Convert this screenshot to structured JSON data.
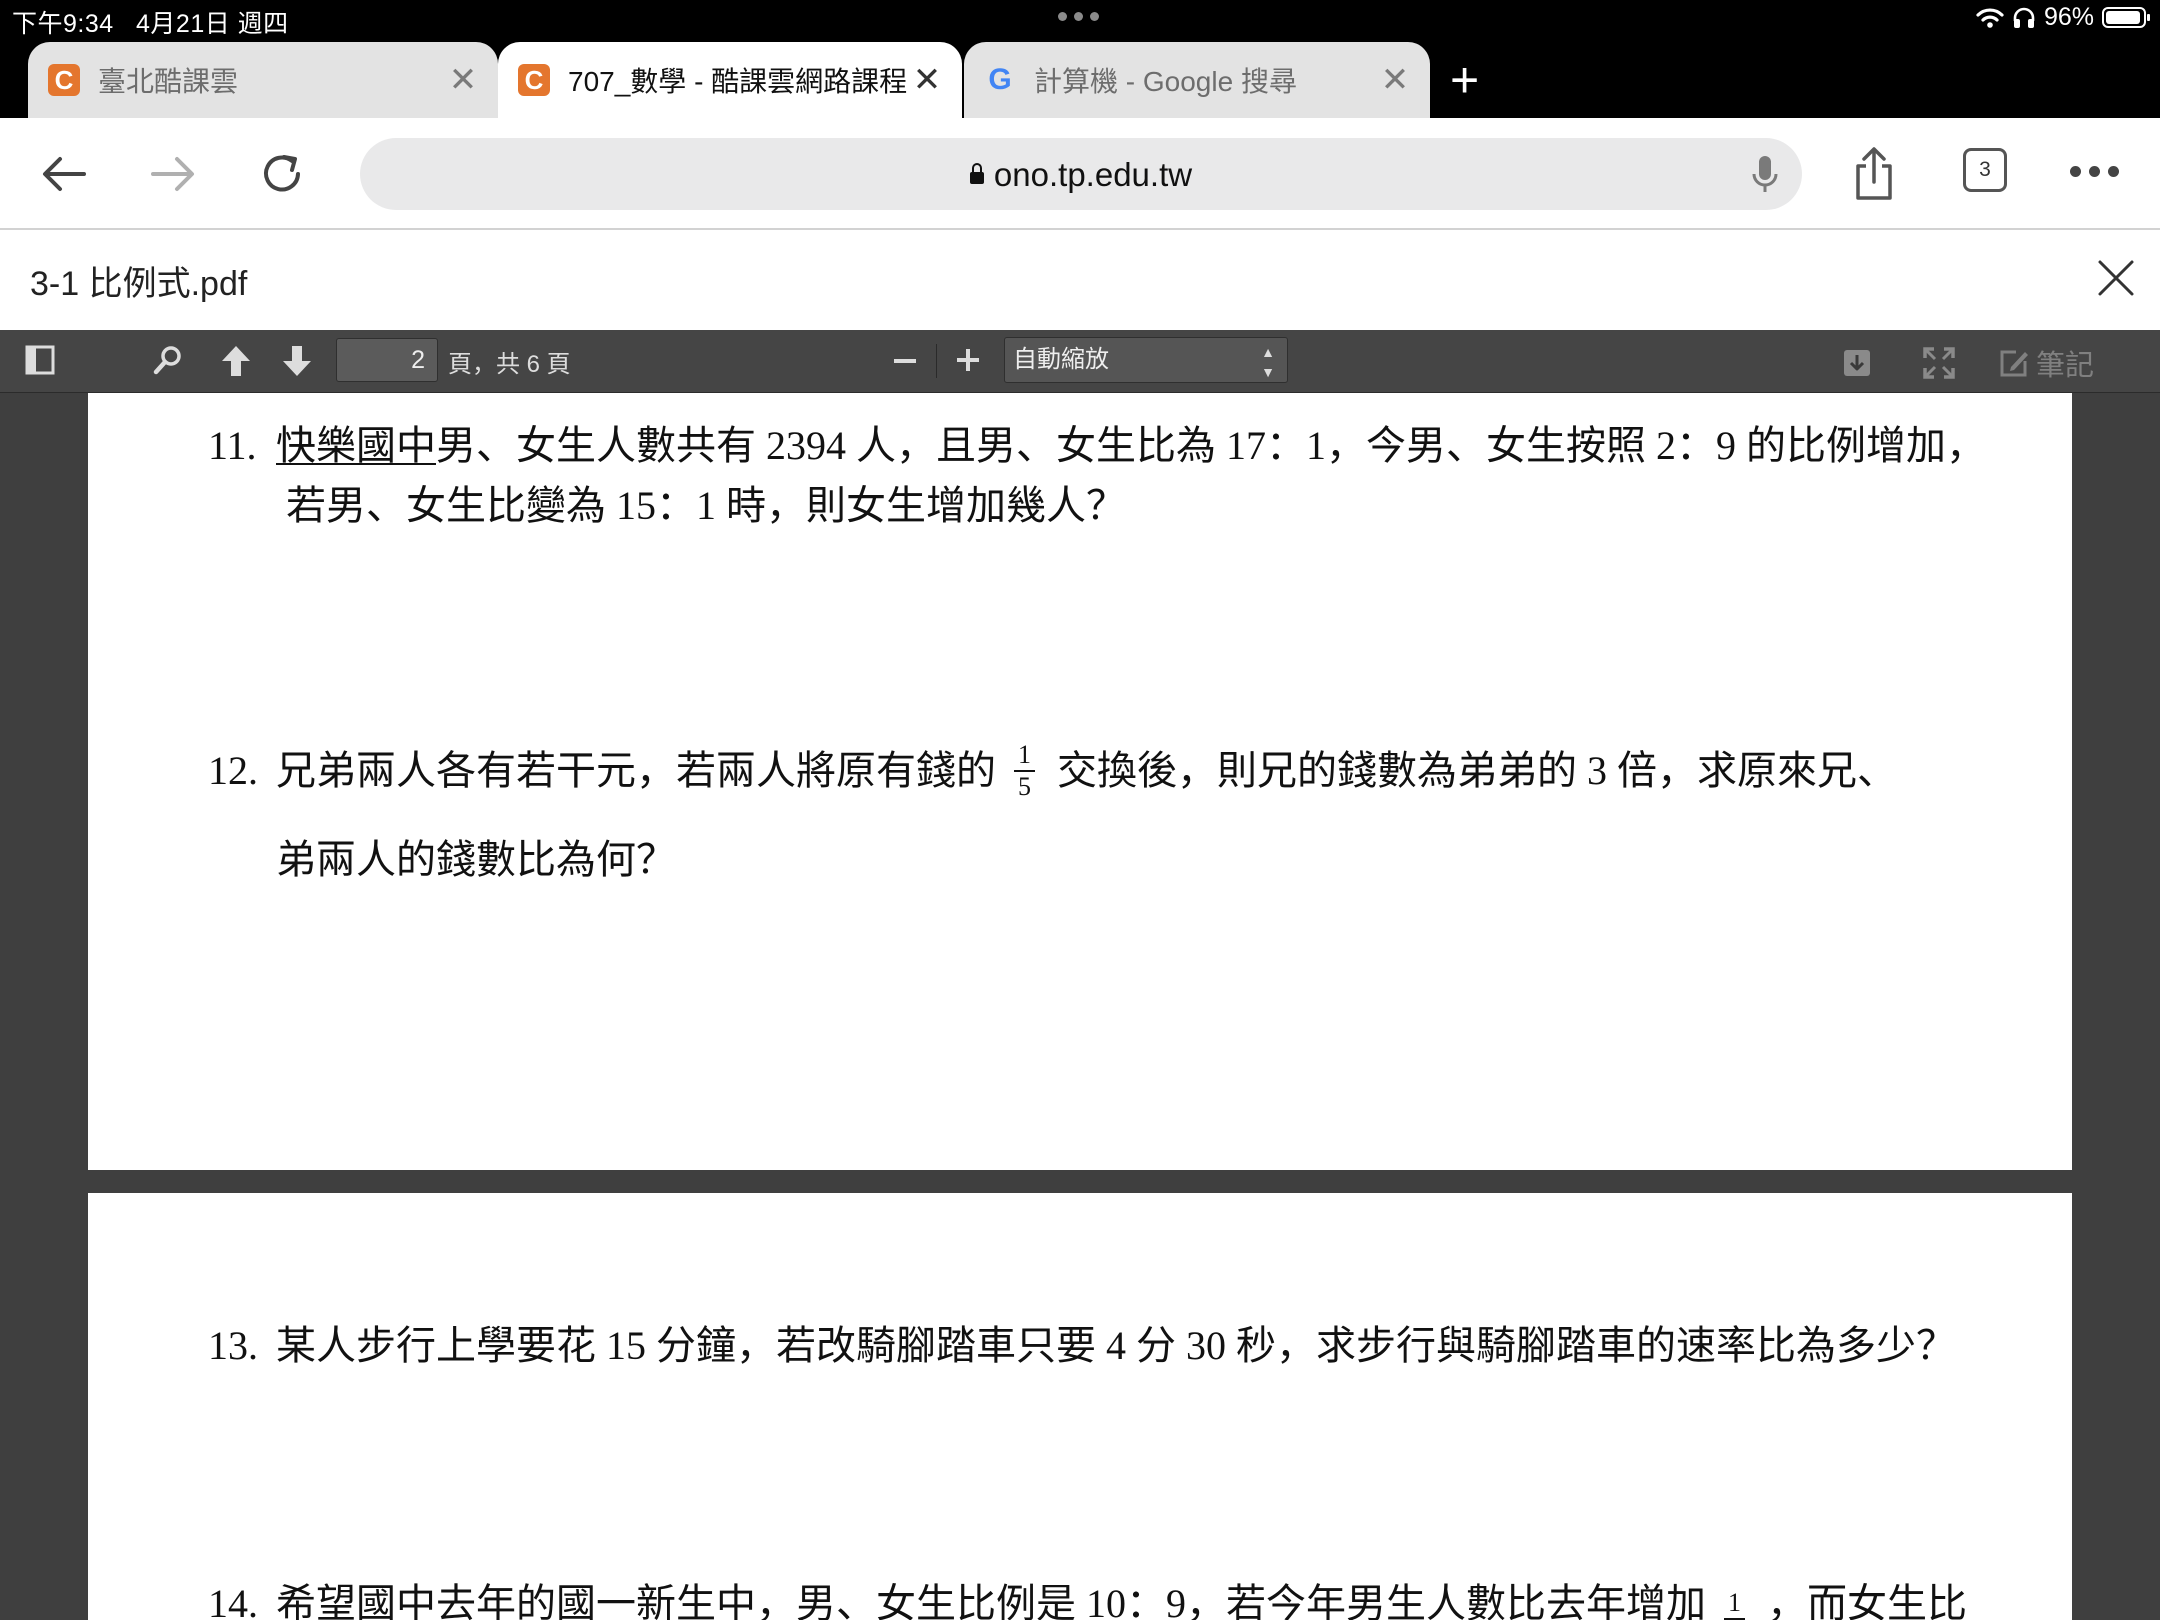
{
  "status_bar": {
    "time": "下午9:34",
    "date": "4月21日 週四",
    "battery": "96%",
    "battery_level": 0.96
  },
  "tabs": [
    {
      "title": "臺北酷課雲",
      "favicon": "cooc-icon",
      "active": false
    },
    {
      "title": "707_數學 - 酷課雲網路課程",
      "favicon": "cooc-icon",
      "active": true
    },
    {
      "title": "計算機 - Google 搜尋",
      "favicon": "google-icon",
      "active": false
    }
  ],
  "address_bar": {
    "url": "ono.tp.edu.tw",
    "tab_count": "3"
  },
  "file": {
    "title": "3-1 比例式.pdf"
  },
  "pdf_toolbar": {
    "page_number": "2",
    "page_total": "頁，共 6 頁",
    "zoom": "自動縮放",
    "notes_label": "筆記"
  },
  "document": {
    "q11": {
      "number": "11.",
      "school": "快樂國中",
      "line1_rest": "男、女生人數共有 2394 人，且男、女生比為 17：1，今男、女生按照 2：9 的比例增加，",
      "line2": "若男、女生比變為 15：1 時，則女生增加幾人？"
    },
    "q12": {
      "number": "12.",
      "line1_a": "兄弟兩人各有若干元，若兩人將原有錢的",
      "frac_num": "1",
      "frac_den": "5",
      "line1_b": "交換後，則兄的錢數為弟弟的 3 倍，求原來兄、",
      "line2": "弟兩人的錢數比為何？"
    },
    "q13": {
      "number": "13.",
      "text": "某人步行上學要花 15 分鐘，若改騎腳踏車只要 4 分 30 秒，求步行與騎腳踏車的速率比為多少？"
    },
    "q14": {
      "number": "14.",
      "line1_a": "希望國中去年的國一新生中，男、女生比例是 10：9，若今年男生人數比去年增加",
      "frac_num": "1",
      "line1_b": "，而女生比"
    }
  }
}
